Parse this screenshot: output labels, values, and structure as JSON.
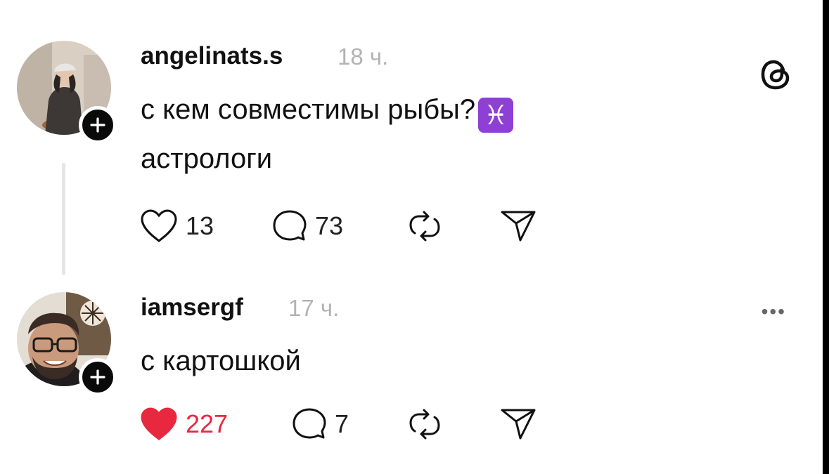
{
  "posts": [
    {
      "username": "angelinats.s",
      "time": "18 ч.",
      "text_line1": "с кем совместимы рыбы?",
      "emoji": "♓",
      "text_line2": "астрологи",
      "likes": "13",
      "replies": "73",
      "liked": false
    },
    {
      "username": "iamsergf",
      "time": "17 ч.",
      "text_line1": "с картошкой",
      "likes": "227",
      "replies": "7",
      "liked": true
    }
  ],
  "more_label": "•••",
  "colors": {
    "like_active": "#e8283e",
    "time_gray": "#b3b3b3",
    "pisces_bg": "#8e3fd6"
  },
  "icons": [
    "threads-logo-icon",
    "heart-icon",
    "comment-icon",
    "repost-icon",
    "share-icon",
    "plus-icon",
    "more-icon"
  ]
}
